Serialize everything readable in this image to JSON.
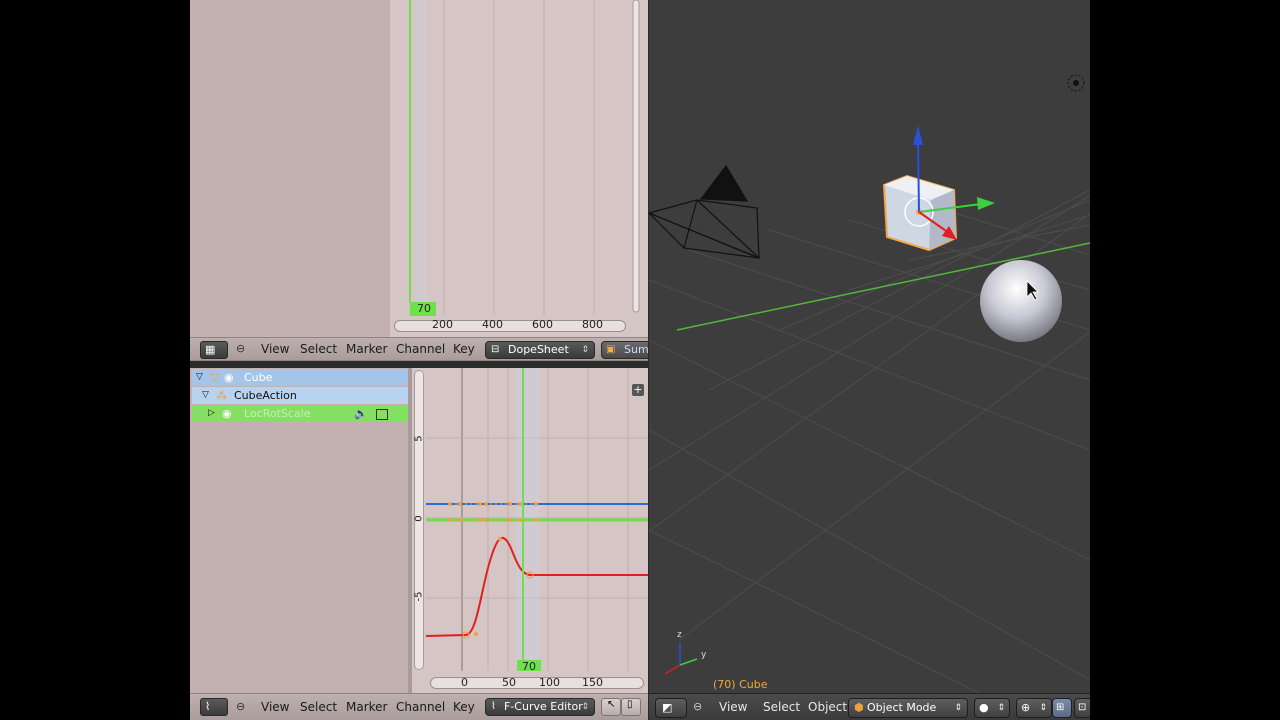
{
  "timeline": {
    "current_frame": "70",
    "ticks": [
      "200",
      "400",
      "600",
      "800"
    ]
  },
  "dopesheet_header": {
    "menus": [
      "View",
      "Select",
      "Marker",
      "Channel",
      "Key"
    ],
    "mode_label": "DopeSheet",
    "summary_label": "Sum"
  },
  "channels": {
    "object": "Cube",
    "action": "CubeAction",
    "group": "LocRotScale"
  },
  "graph": {
    "y_ticks": [
      "5",
      "0",
      "-5"
    ],
    "x_ticks": [
      "0",
      "50",
      "100",
      "150"
    ],
    "current_frame": "70"
  },
  "fcurve_header": {
    "menus": [
      "View",
      "Select",
      "Marker",
      "Channel",
      "Key"
    ],
    "mode_label": "F-Curve Editor"
  },
  "viewport": {
    "object_info": "(70) Cube",
    "axis_labels": {
      "z": "z",
      "y": "y",
      "x": "x"
    }
  },
  "viewport_header": {
    "menus": [
      "View",
      "Select",
      "Object"
    ],
    "mode_label": "Object Mode"
  },
  "colors": {
    "accent_green": "#6fe04a",
    "accent_blue": "#2b6bd6",
    "curve_red": "#e02020",
    "keyframe_orange": "#f0a040",
    "selection_orange": "#f4a640"
  }
}
